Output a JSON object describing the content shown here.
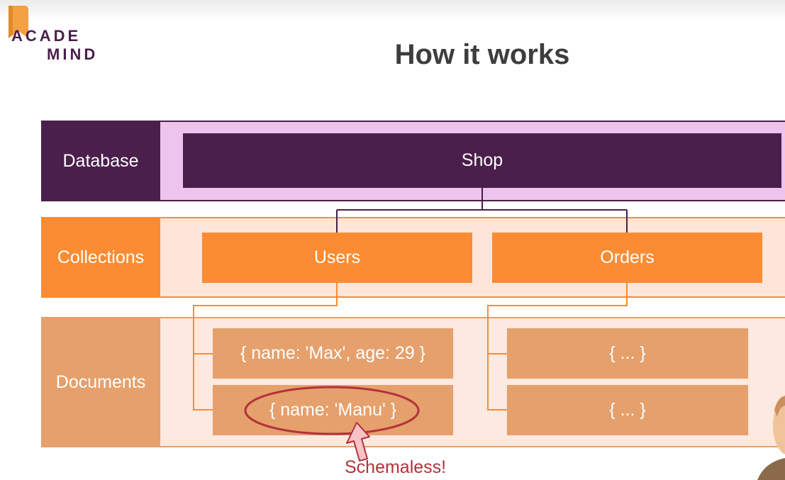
{
  "logo": {
    "line1": "ACADE",
    "line2": "MIND"
  },
  "title": "How it works",
  "rows": {
    "database": {
      "label": "Database",
      "item": "Shop"
    },
    "collections": {
      "label": "Collections",
      "items": [
        "Users",
        "Orders"
      ]
    },
    "documents": {
      "label": "Documents",
      "users_docs": [
        "{ name: 'Max', age: 29 }",
        "{ name: 'Manu' }"
      ],
      "orders_docs": [
        "{ ... }",
        "{ ... }"
      ]
    }
  },
  "callout": "Schemaless!",
  "colors": {
    "database_dark": "#4a1f4b",
    "database_light": "#ecc4ec",
    "collections_accent": "#fb8c33",
    "collections_light": "#fde6d9",
    "documents_accent": "#e5a06c",
    "documents_light": "#fce9e0",
    "callout": "#b3313a"
  }
}
